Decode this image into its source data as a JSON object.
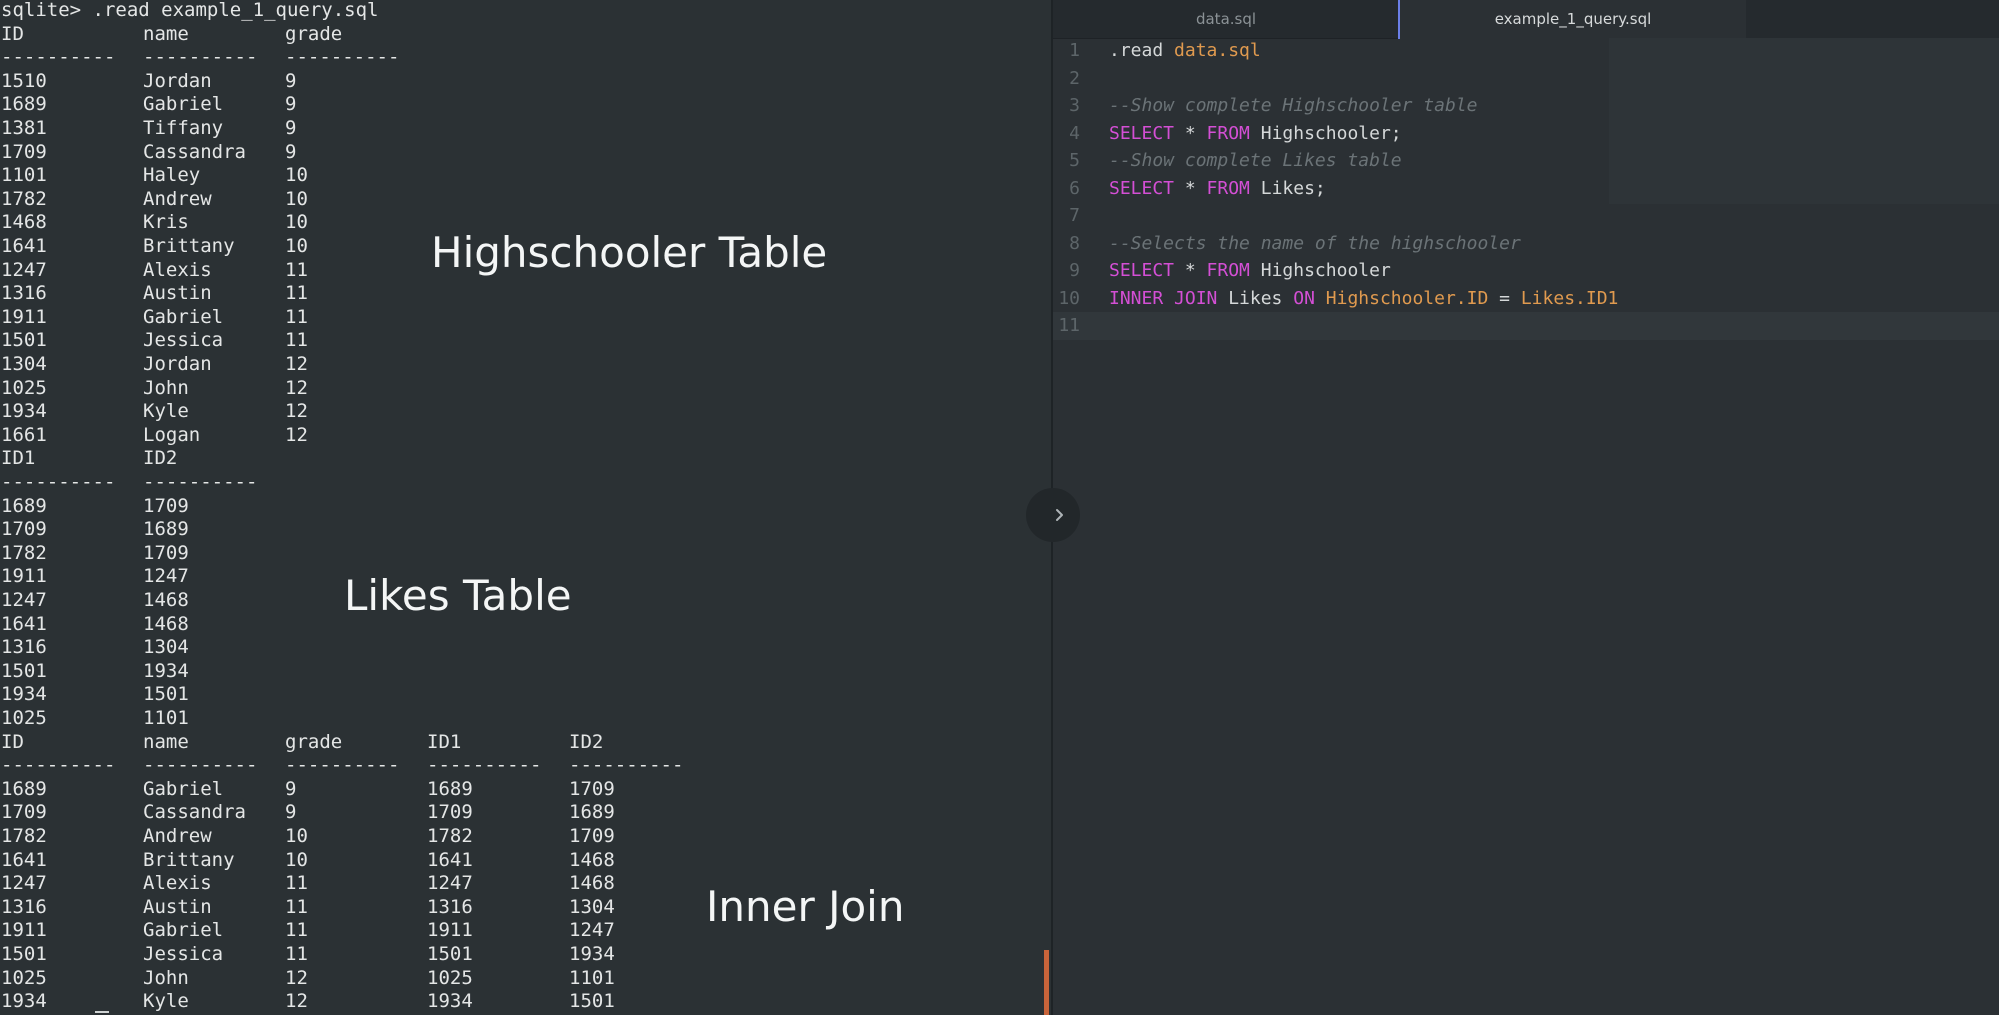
{
  "terminal": {
    "command_line": "sqlite> .read example_1_query.sql",
    "highschooler": {
      "headers": [
        "ID",
        "name",
        "grade"
      ],
      "separators": [
        "----------",
        "----------",
        "----------"
      ],
      "rows": [
        [
          "1510",
          "Jordan",
          "9"
        ],
        [
          "1689",
          "Gabriel",
          "9"
        ],
        [
          "1381",
          "Tiffany",
          "9"
        ],
        [
          "1709",
          "Cassandra",
          "9"
        ],
        [
          "1101",
          "Haley",
          "10"
        ],
        [
          "1782",
          "Andrew",
          "10"
        ],
        [
          "1468",
          "Kris",
          "10"
        ],
        [
          "1641",
          "Brittany",
          "10"
        ],
        [
          "1247",
          "Alexis",
          "11"
        ],
        [
          "1316",
          "Austin",
          "11"
        ],
        [
          "1911",
          "Gabriel",
          "11"
        ],
        [
          "1501",
          "Jessica",
          "11"
        ],
        [
          "1304",
          "Jordan",
          "12"
        ],
        [
          "1025",
          "John",
          "12"
        ],
        [
          "1934",
          "Kyle",
          "12"
        ],
        [
          "1661",
          "Logan",
          "12"
        ]
      ]
    },
    "likes": {
      "headers": [
        "ID1",
        "ID2"
      ],
      "separators": [
        "----------",
        "----------"
      ],
      "rows": [
        [
          "1689",
          "1709"
        ],
        [
          "1709",
          "1689"
        ],
        [
          "1782",
          "1709"
        ],
        [
          "1911",
          "1247"
        ],
        [
          "1247",
          "1468"
        ],
        [
          "1641",
          "1468"
        ],
        [
          "1316",
          "1304"
        ],
        [
          "1501",
          "1934"
        ],
        [
          "1934",
          "1501"
        ],
        [
          "1025",
          "1101"
        ]
      ]
    },
    "join": {
      "headers": [
        "ID",
        "name",
        "grade",
        "ID1",
        "ID2"
      ],
      "separators": [
        "----------",
        "----------",
        "----------",
        "----------",
        "----------"
      ],
      "rows": [
        [
          "1689",
          "Gabriel",
          "9",
          "1689",
          "1709"
        ],
        [
          "1709",
          "Cassandra",
          "9",
          "1709",
          "1689"
        ],
        [
          "1782",
          "Andrew",
          "10",
          "1782",
          "1709"
        ],
        [
          "1641",
          "Brittany",
          "10",
          "1641",
          "1468"
        ],
        [
          "1247",
          "Alexis",
          "11",
          "1247",
          "1468"
        ],
        [
          "1316",
          "Austin",
          "11",
          "1316",
          "1304"
        ],
        [
          "1911",
          "Gabriel",
          "11",
          "1911",
          "1247"
        ],
        [
          "1501",
          "Jessica",
          "11",
          "1501",
          "1934"
        ],
        [
          "1025",
          "John",
          "12",
          "1025",
          "1101"
        ],
        [
          "1934",
          "Kyle",
          "12",
          "1934",
          "1501"
        ]
      ]
    }
  },
  "annotations": {
    "highschooler_table": "Highschooler Table",
    "likes_table": "Likes Table",
    "inner_join": "Inner Join"
  },
  "editor": {
    "tabs": [
      {
        "label": "data.sql",
        "active": false
      },
      {
        "label": "example_1_query.sql",
        "active": true
      }
    ],
    "current_line": 11,
    "lines": [
      {
        "num": "1",
        "tokens": [
          {
            "t": ".read ",
            "k": "id"
          },
          {
            "t": "data.sql",
            "k": "fn"
          }
        ]
      },
      {
        "num": "2",
        "tokens": []
      },
      {
        "num": "3",
        "tokens": [
          {
            "t": "--Show complete Highschooler table",
            "k": "cm"
          }
        ]
      },
      {
        "num": "4",
        "tokens": [
          {
            "t": "SELECT",
            "k": "kw"
          },
          {
            "t": " * ",
            "k": "op"
          },
          {
            "t": "FROM",
            "k": "kw"
          },
          {
            "t": " Highschooler;",
            "k": "id"
          }
        ]
      },
      {
        "num": "5",
        "tokens": [
          {
            "t": "--Show complete Likes table",
            "k": "cm"
          }
        ]
      },
      {
        "num": "6",
        "tokens": [
          {
            "t": "SELECT",
            "k": "kw"
          },
          {
            "t": " * ",
            "k": "op"
          },
          {
            "t": "FROM",
            "k": "kw"
          },
          {
            "t": " Likes;",
            "k": "id"
          }
        ]
      },
      {
        "num": "7",
        "tokens": []
      },
      {
        "num": "8",
        "tokens": [
          {
            "t": "--Selects the name of the highschooler",
            "k": "cm"
          }
        ]
      },
      {
        "num": "9",
        "tokens": [
          {
            "t": "SELECT",
            "k": "kw"
          },
          {
            "t": " * ",
            "k": "op"
          },
          {
            "t": "FROM",
            "k": "kw"
          },
          {
            "t": " Highschooler",
            "k": "id"
          }
        ]
      },
      {
        "num": "10",
        "tokens": [
          {
            "t": "INNER JOIN",
            "k": "kw"
          },
          {
            "t": " Likes ",
            "k": "id"
          },
          {
            "t": "ON",
            "k": "kw"
          },
          {
            "t": " ",
            "k": "id"
          },
          {
            "t": "Highschooler.ID",
            "k": "fn"
          },
          {
            "t": " = ",
            "k": "op"
          },
          {
            "t": "Likes.ID1",
            "k": "fn"
          }
        ]
      },
      {
        "num": "11",
        "tokens": []
      }
    ]
  },
  "icons": {
    "collapse": "chevron-right-icon"
  },
  "colors": {
    "keyword": "#d44fd5",
    "function": "#e09a4f",
    "comment": "#6b7377",
    "active_tab_accent": "#6b7fe8",
    "terminal_scroll": "#c8643a"
  }
}
